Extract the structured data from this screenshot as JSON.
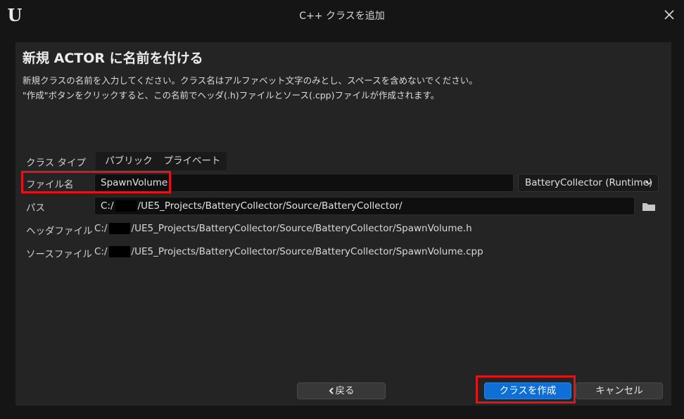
{
  "window": {
    "title": "C++ クラスを追加",
    "logo_glyph": "U"
  },
  "heading": "新規 ACTOR に名前を付ける",
  "description": {
    "line1": "新規クラスの名前を入力してください。クラス名はアルファベット文字のみとし、スペースを含めないでください。",
    "line2": "\"作成\"ボタンをクリックすると、この名前でヘッダ(.h)ファイルとソース(.cpp)ファイルが作成されます。"
  },
  "class_type": {
    "label": "クラス タイプ",
    "options": [
      "パブリック",
      "プライベート"
    ]
  },
  "file_name": {
    "label": "ファイル名",
    "value": "SpawnVolume"
  },
  "module_dropdown": {
    "value": "BatteryCollector (Runtime)"
  },
  "path": {
    "label": "パス",
    "prefix": "C:/",
    "suffix": "/UE5_Projects/BatteryCollector/Source/BatteryCollector/"
  },
  "header_file": {
    "label": "ヘッダファイル",
    "prefix": "C:/",
    "suffix": "/UE5_Projects/BatteryCollector/Source/BatteryCollector/SpawnVolume.h"
  },
  "source_file": {
    "label": "ソースファイル",
    "prefix": "C:/",
    "suffix": "/UE5_Projects/BatteryCollector/Source/BatteryCollector/SpawnVolume.cpp"
  },
  "buttons": {
    "back": "戻る",
    "create": "クラスを作成",
    "cancel": "キャンセル"
  },
  "colors": {
    "accent": "#0f6fd6",
    "highlight": "#e0141a",
    "background": "#242424"
  },
  "icons": {
    "close": "close-icon",
    "folder": "folder-icon",
    "chevron": "chevron-down-icon",
    "back": "chevron-left-icon"
  }
}
